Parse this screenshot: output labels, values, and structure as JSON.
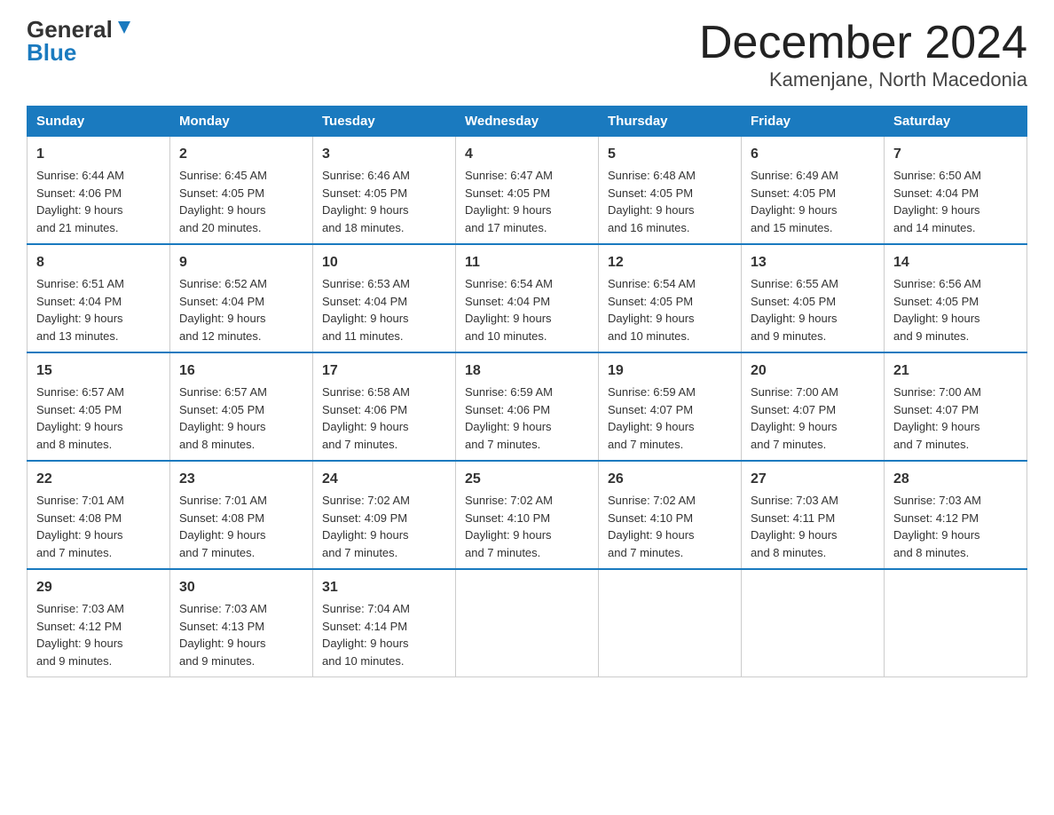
{
  "header": {
    "title": "December 2024",
    "subtitle": "Kamenjane, North Macedonia",
    "logo_general": "General",
    "logo_blue": "Blue"
  },
  "days_of_week": [
    "Sunday",
    "Monday",
    "Tuesday",
    "Wednesday",
    "Thursday",
    "Friday",
    "Saturday"
  ],
  "weeks": [
    [
      {
        "day": "1",
        "sunrise": "6:44 AM",
        "sunset": "4:06 PM",
        "daylight": "9 hours and 21 minutes."
      },
      {
        "day": "2",
        "sunrise": "6:45 AM",
        "sunset": "4:05 PM",
        "daylight": "9 hours and 20 minutes."
      },
      {
        "day": "3",
        "sunrise": "6:46 AM",
        "sunset": "4:05 PM",
        "daylight": "9 hours and 18 minutes."
      },
      {
        "day": "4",
        "sunrise": "6:47 AM",
        "sunset": "4:05 PM",
        "daylight": "9 hours and 17 minutes."
      },
      {
        "day": "5",
        "sunrise": "6:48 AM",
        "sunset": "4:05 PM",
        "daylight": "9 hours and 16 minutes."
      },
      {
        "day": "6",
        "sunrise": "6:49 AM",
        "sunset": "4:05 PM",
        "daylight": "9 hours and 15 minutes."
      },
      {
        "day": "7",
        "sunrise": "6:50 AM",
        "sunset": "4:04 PM",
        "daylight": "9 hours and 14 minutes."
      }
    ],
    [
      {
        "day": "8",
        "sunrise": "6:51 AM",
        "sunset": "4:04 PM",
        "daylight": "9 hours and 13 minutes."
      },
      {
        "day": "9",
        "sunrise": "6:52 AM",
        "sunset": "4:04 PM",
        "daylight": "9 hours and 12 minutes."
      },
      {
        "day": "10",
        "sunrise": "6:53 AM",
        "sunset": "4:04 PM",
        "daylight": "9 hours and 11 minutes."
      },
      {
        "day": "11",
        "sunrise": "6:54 AM",
        "sunset": "4:04 PM",
        "daylight": "9 hours and 10 minutes."
      },
      {
        "day": "12",
        "sunrise": "6:54 AM",
        "sunset": "4:05 PM",
        "daylight": "9 hours and 10 minutes."
      },
      {
        "day": "13",
        "sunrise": "6:55 AM",
        "sunset": "4:05 PM",
        "daylight": "9 hours and 9 minutes."
      },
      {
        "day": "14",
        "sunrise": "6:56 AM",
        "sunset": "4:05 PM",
        "daylight": "9 hours and 9 minutes."
      }
    ],
    [
      {
        "day": "15",
        "sunrise": "6:57 AM",
        "sunset": "4:05 PM",
        "daylight": "9 hours and 8 minutes."
      },
      {
        "day": "16",
        "sunrise": "6:57 AM",
        "sunset": "4:05 PM",
        "daylight": "9 hours and 8 minutes."
      },
      {
        "day": "17",
        "sunrise": "6:58 AM",
        "sunset": "4:06 PM",
        "daylight": "9 hours and 7 minutes."
      },
      {
        "day": "18",
        "sunrise": "6:59 AM",
        "sunset": "4:06 PM",
        "daylight": "9 hours and 7 minutes."
      },
      {
        "day": "19",
        "sunrise": "6:59 AM",
        "sunset": "4:07 PM",
        "daylight": "9 hours and 7 minutes."
      },
      {
        "day": "20",
        "sunrise": "7:00 AM",
        "sunset": "4:07 PM",
        "daylight": "9 hours and 7 minutes."
      },
      {
        "day": "21",
        "sunrise": "7:00 AM",
        "sunset": "4:07 PM",
        "daylight": "9 hours and 7 minutes."
      }
    ],
    [
      {
        "day": "22",
        "sunrise": "7:01 AM",
        "sunset": "4:08 PM",
        "daylight": "9 hours and 7 minutes."
      },
      {
        "day": "23",
        "sunrise": "7:01 AM",
        "sunset": "4:08 PM",
        "daylight": "9 hours and 7 minutes."
      },
      {
        "day": "24",
        "sunrise": "7:02 AM",
        "sunset": "4:09 PM",
        "daylight": "9 hours and 7 minutes."
      },
      {
        "day": "25",
        "sunrise": "7:02 AM",
        "sunset": "4:10 PM",
        "daylight": "9 hours and 7 minutes."
      },
      {
        "day": "26",
        "sunrise": "7:02 AM",
        "sunset": "4:10 PM",
        "daylight": "9 hours and 7 minutes."
      },
      {
        "day": "27",
        "sunrise": "7:03 AM",
        "sunset": "4:11 PM",
        "daylight": "9 hours and 8 minutes."
      },
      {
        "day": "28",
        "sunrise": "7:03 AM",
        "sunset": "4:12 PM",
        "daylight": "9 hours and 8 minutes."
      }
    ],
    [
      {
        "day": "29",
        "sunrise": "7:03 AM",
        "sunset": "4:12 PM",
        "daylight": "9 hours and 9 minutes."
      },
      {
        "day": "30",
        "sunrise": "7:03 AM",
        "sunset": "4:13 PM",
        "daylight": "9 hours and 9 minutes."
      },
      {
        "day": "31",
        "sunrise": "7:04 AM",
        "sunset": "4:14 PM",
        "daylight": "9 hours and 10 minutes."
      },
      null,
      null,
      null,
      null
    ]
  ],
  "labels": {
    "sunrise": "Sunrise:",
    "sunset": "Sunset:",
    "daylight": "Daylight:"
  }
}
